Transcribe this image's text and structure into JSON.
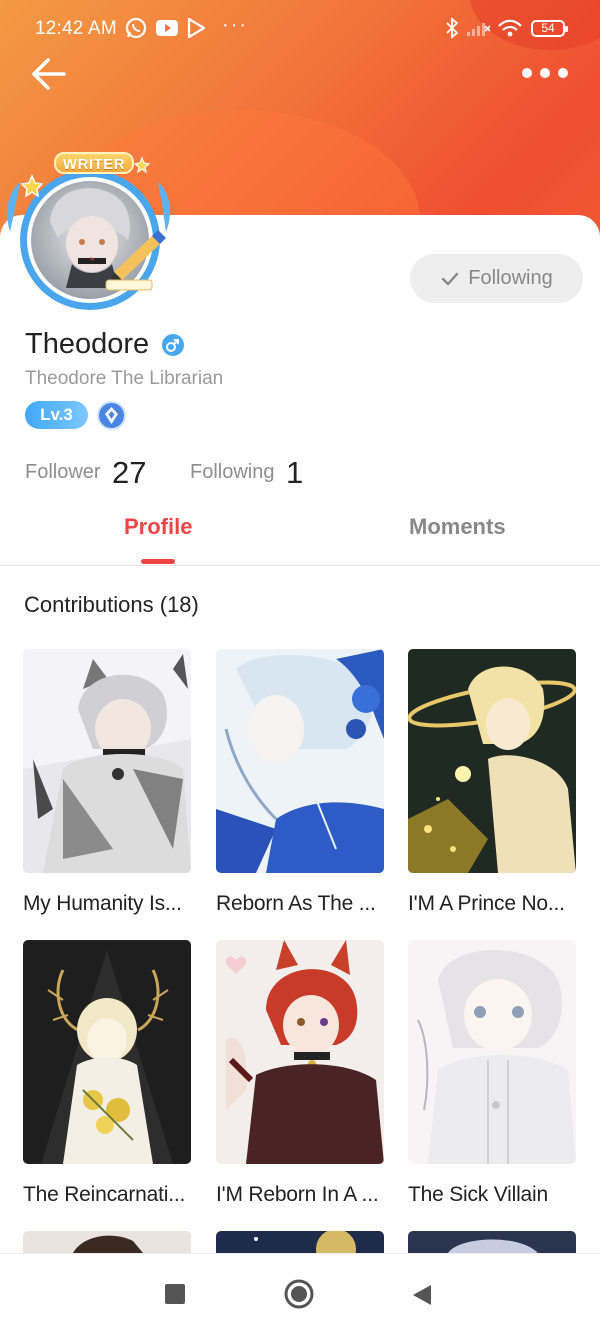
{
  "status_bar": {
    "time": "12:42 AM",
    "battery": "54",
    "icons": [
      "whatsapp-icon",
      "youtube-icon",
      "play-store-icon",
      "more-dots",
      "bluetooth-icon",
      "signal-icon",
      "wifi-icon",
      "battery-icon"
    ]
  },
  "header": {
    "back_icon": "arrow-left-icon",
    "more_icon": "more-horizontal-icon"
  },
  "profile": {
    "badge": "WRITER",
    "name": "Theodore",
    "gender_icon": "male-icon",
    "subtitle": "Theodore The Librarian",
    "level": "Lv.3",
    "follow_button": "Following",
    "stats": {
      "follower_label": "Follower",
      "follower_value": "27",
      "following_label": "Following",
      "following_value": "1"
    }
  },
  "tabs": [
    {
      "label": "Profile",
      "active": true
    },
    {
      "label": "Moments",
      "active": false
    }
  ],
  "contributions": {
    "title": "Contributions (18)",
    "books": [
      {
        "title": "My Humanity Is..."
      },
      {
        "title": "Reborn As The ..."
      },
      {
        "title": "I'M A Prince No..."
      },
      {
        "title": "The Reincarnati..."
      },
      {
        "title": "I'M Reborn In A ..."
      },
      {
        "title": "The Sick Villain"
      }
    ]
  },
  "colors": {
    "accent": "#ef4444",
    "header_orange": "#f2733a",
    "level_blue": "#42a8f6"
  }
}
